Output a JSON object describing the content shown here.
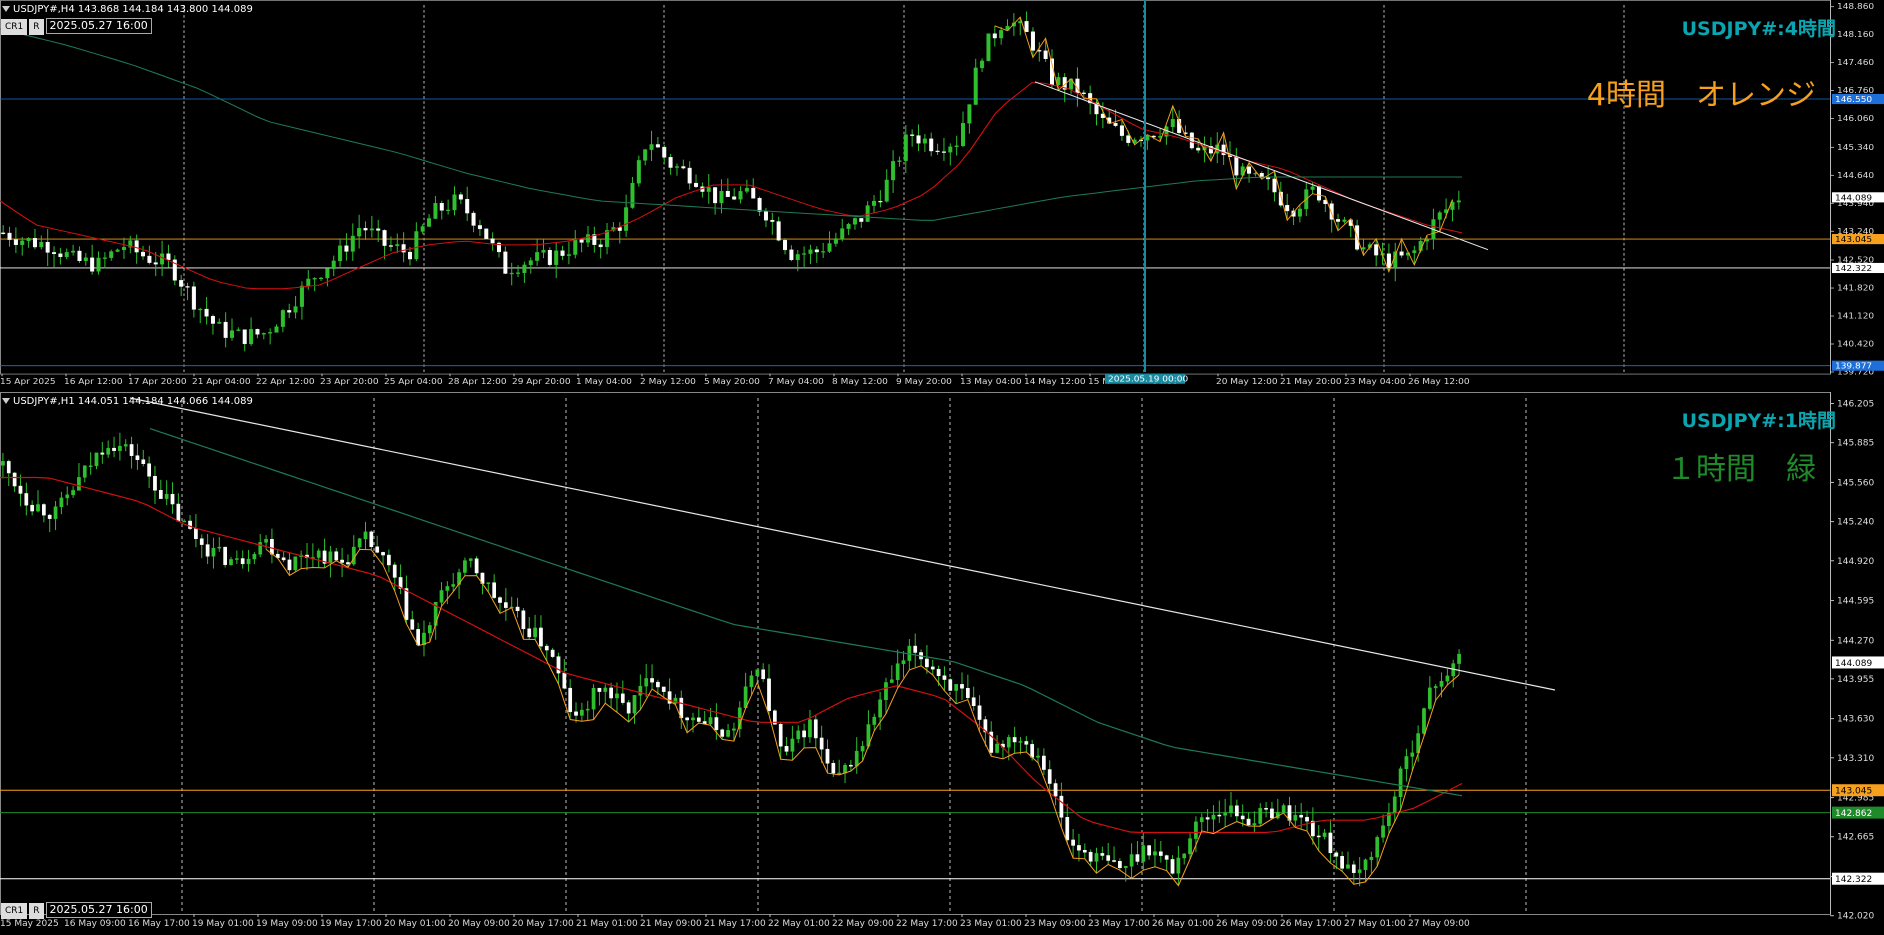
{
  "panels": [
    {
      "id": "h4",
      "header": "USDJPY#,H4  143.868 144.184 143.800 144.089",
      "datebox": "2025.05.27 16:00",
      "symbol_label": "USDJPY#:4時間",
      "note_label": "4時間　オレンジ",
      "note_color": "#f6a01e",
      "crosshair_time": "2025.05.19 00:00",
      "price_tags": [
        {
          "value": "146.550",
          "color": "#1e6fd9"
        },
        {
          "value": "144.089",
          "color": "#ffffff"
        },
        {
          "value": "143.045",
          "color": "#f6a01e"
        },
        {
          "value": "142.322",
          "color": "#ffffff"
        },
        {
          "value": "139.877",
          "color": "#1e6fd9"
        }
      ]
    },
    {
      "id": "h1",
      "header": "USDJPY#,H1  144.051 144.184 144.066 144.089",
      "datebox": "2025.05.27 16:00",
      "symbol_label": "USDJPY#:1時間",
      "note_label": "１時間　緑",
      "note_color": "#1f8a2a",
      "price_tags": [
        {
          "value": "144.089",
          "color": "#ffffff"
        },
        {
          "value": "143.045",
          "color": "#f6a01e"
        },
        {
          "value": "142.862",
          "color": "#1f8a2a"
        },
        {
          "value": "142.322",
          "color": "#ffffff"
        }
      ]
    }
  ],
  "chart_data": [
    {
      "type": "candlestick",
      "symbol": "USDJPY#",
      "timeframe": "H4",
      "ylim": [
        139.72,
        148.9
      ],
      "y_ticks": [
        "148.860",
        "148.160",
        "147.460",
        "146.760",
        "146.060",
        "145.340",
        "144.640",
        "143.940",
        "143.240",
        "142.520",
        "141.820",
        "141.120",
        "140.420",
        "139.720"
      ],
      "x_ticks": [
        "15 Apr 2025",
        "16 Apr 12:00",
        "17 Apr 20:00",
        "21 Apr 04:00",
        "22 Apr 12:00",
        "23 Apr 20:00",
        "25 Apr 04:00",
        "28 Apr 12:00",
        "29 Apr 20:00",
        "1 May 04:00",
        "2 May 12:00",
        "5 May 20:00",
        "7 May 04:00",
        "8 May 12:00",
        "9 May 20:00",
        "13 May 04:00",
        "14 May 12:00",
        "15 M",
        "04:00",
        "20 May 12:00",
        "21 May 20:00",
        "23 May 04:00",
        "26 May 12:00"
      ],
      "close_path": [
        143.2,
        143.0,
        142.9,
        142.5,
        142.4,
        142.9,
        142.6,
        142.4,
        141.5,
        140.8,
        140.6,
        140.7,
        141.4,
        142.1,
        142.6,
        143.4,
        142.9,
        142.7,
        143.7,
        144.0,
        143.4,
        142.3,
        142.5,
        142.6,
        142.9,
        143.0,
        143.5,
        145.6,
        144.9,
        144.6,
        144.0,
        144.2,
        143.7,
        142.7,
        142.7,
        143.1,
        143.6,
        144.4,
        145.7,
        145.4,
        145.5,
        147.7,
        148.6,
        148.1,
        147.0,
        146.8,
        146.0,
        145.6,
        145.7,
        145.9,
        145.2,
        145.3,
        144.6,
        144.4,
        143.8,
        144.3,
        143.5,
        142.8,
        142.5,
        142.6,
        143.5,
        144.1
      ],
      "horizontal_lines": [
        146.55,
        143.045,
        142.322,
        139.877
      ],
      "trendline": {
        "from": [
          142,
          147.1
        ],
        "to": [
          185,
          142.9
        ]
      },
      "series": [
        {
          "name": "",
          "color": "#d01010",
          "path": [
            144.0,
            143.4,
            143.2,
            143.0,
            142.8,
            142.4,
            142.0,
            141.8,
            141.8,
            141.9,
            142.3,
            142.7,
            142.9,
            143.0,
            142.9,
            142.9,
            143.0,
            143.2,
            143.6,
            144.1,
            144.4,
            144.4,
            144.1,
            143.8,
            143.6,
            143.8,
            144.2,
            145.0,
            146.3,
            147.0,
            146.8,
            146.3,
            145.8,
            145.6,
            145.3,
            145.0,
            144.8,
            144.4,
            144.0,
            143.7,
            143.4,
            143.2
          ]
        },
        {
          "name": "",
          "color": "#1e7a55",
          "path": [
            148.3,
            147.9,
            147.4,
            146.8,
            146.0,
            145.6,
            145.2,
            144.7,
            144.3,
            144.0,
            143.9,
            143.8,
            143.7,
            143.6,
            143.5,
            143.8,
            144.1,
            144.3,
            144.5,
            144.6,
            144.6,
            144.6,
            144.6
          ]
        }
      ]
    },
    {
      "type": "candlestick",
      "symbol": "USDJPY#",
      "timeframe": "H1",
      "ylim": [
        142.05,
        146.25
      ],
      "y_ticks": [
        "146.205",
        "145.885",
        "145.560",
        "145.240",
        "144.920",
        "144.595",
        "144.270",
        "143.955",
        "143.630",
        "143.310",
        "142.985",
        "142.665",
        "142.340",
        "142.020"
      ],
      "x_ticks": [
        "15 May 2025",
        "16 May 09:00",
        "16 May 17:00",
        "19 May 01:00",
        "19 May 09:00",
        "19 May 17:00",
        "20 May 01:00",
        "20 May 09:00",
        "20 May 17:00",
        "21 May 01:00",
        "21 May 09:00",
        "21 May 17:00",
        "22 May 01:00",
        "22 May 09:00",
        "22 May 17:00",
        "23 May 01:00",
        "23 May 09:00",
        "23 May 17:00",
        "26 May 01:00",
        "26 May 09:00",
        "26 May 17:00",
        "27 May 01:00",
        "27 May 09:00"
      ],
      "close_path": [
        145.7,
        145.4,
        145.3,
        145.6,
        145.9,
        145.8,
        145.5,
        145.2,
        145.0,
        144.9,
        145.1,
        144.9,
        145.0,
        144.9,
        145.1,
        144.8,
        144.2,
        144.7,
        144.9,
        144.6,
        144.4,
        144.2,
        143.6,
        143.9,
        143.7,
        144.0,
        143.7,
        143.6,
        143.5,
        144.1,
        143.3,
        143.6,
        143.1,
        143.4,
        143.9,
        144.2,
        144.0,
        143.8,
        143.4,
        143.5,
        143.3,
        142.6,
        142.5,
        142.4,
        142.6,
        142.4,
        142.8,
        142.9,
        142.8,
        142.9,
        142.8,
        142.6,
        142.3,
        142.7,
        143.3,
        143.9,
        144.1
      ],
      "horizontal_lines": [
        143.045,
        142.862,
        142.322
      ],
      "trendline": {
        "from": [
          146.2
        ],
        "to": [
          142.9
        ]
      },
      "series": [
        {
          "name": "",
          "color": "#d01010",
          "path": [
            145.6,
            145.6,
            145.5,
            145.4,
            145.2,
            145.1,
            145.0,
            144.9,
            144.8,
            144.6,
            144.4,
            144.2,
            144.0,
            143.9,
            143.8,
            143.7,
            143.6,
            143.6,
            143.8,
            143.9,
            143.8,
            143.5,
            143.1,
            142.8,
            142.7,
            142.7,
            142.7,
            142.7,
            142.8,
            142.8,
            142.9,
            143.1
          ]
        },
        {
          "name": "",
          "color": "#1e7a55",
          "path": [
            146.0,
            145.8,
            145.6,
            145.4,
            145.2,
            145.0,
            144.8,
            144.6,
            144.4,
            144.3,
            144.2,
            144.1,
            143.9,
            143.6,
            143.4,
            143.3,
            143.2,
            143.1,
            143.0
          ]
        }
      ]
    }
  ]
}
